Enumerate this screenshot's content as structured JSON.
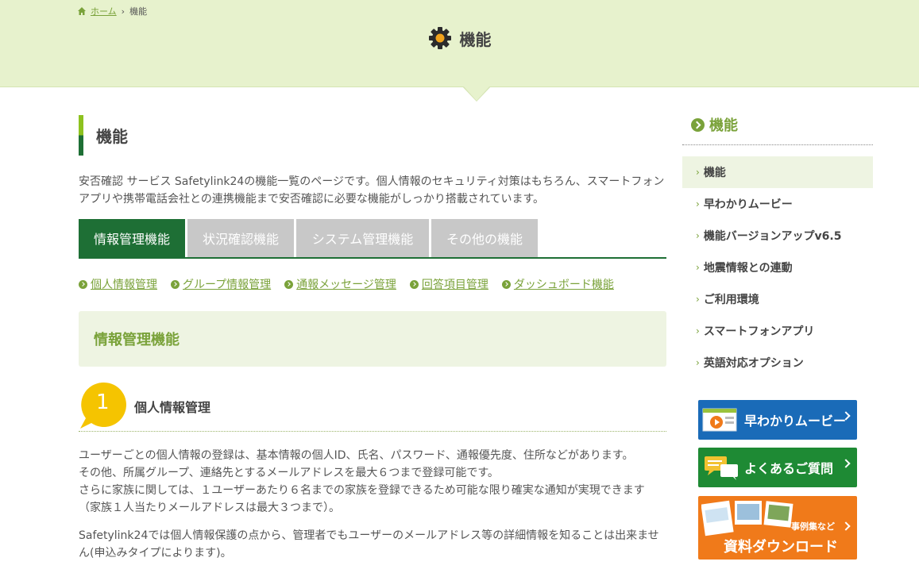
{
  "breadcrumb": {
    "home": "ホーム",
    "separator": "›",
    "current": "機能"
  },
  "hero": {
    "title": "機能"
  },
  "main": {
    "heading": "機能",
    "intro": "安否確認 サービス Safetylink24の機能一覧のページです。個人情報のセキュリティ対策はもちろん、スマートフォンアプリや携帯電話会社との連携機能まで安否確認に必要な機能がしっかり搭載されています。",
    "tabs": [
      {
        "label": "情報管理機能"
      },
      {
        "label": "状況確認機能"
      },
      {
        "label": "システム管理機能"
      },
      {
        "label": "その他の機能"
      }
    ],
    "sublinks": [
      {
        "label": "個人情報管理"
      },
      {
        "label": "グループ情報管理"
      },
      {
        "label": "通報メッセージ管理"
      },
      {
        "label": "回答項目管理"
      },
      {
        "label": "ダッシュボード機能"
      }
    ],
    "section_title": "情報管理機能",
    "feature": {
      "number": "1",
      "title": "個人情報管理",
      "para1_l1": "ユーザーごとの個人情報の登録は、基本情報の個人ID、氏名、パスワード、通報優先度、住所などがあります。",
      "para1_l2": "その他、所属グループ、連絡先とするメールアドレスを最大６つまで登録可能です。",
      "para1_l3": "さらに家族に関しては、１ユーザーあたり６名までの家族を登録できるため可能な限り確実な通知が実現できます",
      "para1_l4": "（家族１人当たりメールアドレスは最大３つまで）。",
      "para2": "Safetylink24では個人情報保護の点から、管理者でもユーザーのメールアドレス等の詳細情報を知ることは出来ません(申込みタイプによります)。"
    }
  },
  "sidebar": {
    "title": "機能",
    "chevron": "›",
    "items": [
      {
        "label": "機能"
      },
      {
        "label": "早わかりムービー"
      },
      {
        "label": "機能バージョンアップv6.5"
      },
      {
        "label": "地震情報との連動"
      },
      {
        "label": "ご利用環境"
      },
      {
        "label": "スマートフォンアプリ"
      },
      {
        "label": "英語対応オプション"
      }
    ],
    "banners": {
      "movie": "早わかりムービー",
      "faq": "よくあるご質問",
      "dl_small": "事例集など",
      "dl_main": "資料ダウンロード"
    }
  },
  "colors": {
    "accent_green": "#7aa23a",
    "dark_green": "#1e6f35",
    "hero_bg": "#e7f2cd",
    "orange": "#f07a1a",
    "blue": "#1a6bb8"
  }
}
